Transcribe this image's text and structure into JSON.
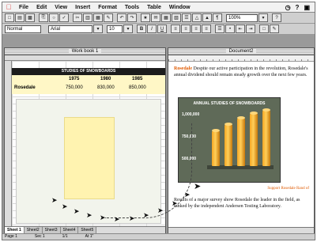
{
  "menubar": {
    "items": [
      "File",
      "Edit",
      "View",
      "Insert",
      "Format",
      "Tools",
      "Table",
      "Window"
    ]
  },
  "toolbar": {
    "zoom": "100%",
    "style": "Normal",
    "font": "Arial",
    "size": "10"
  },
  "excel": {
    "title": "Work book 1",
    "banner": "STUDIES OF SNOWBOARDS",
    "years": [
      "1975",
      "1980",
      "1985"
    ],
    "row_label": "Rosedale",
    "values": [
      "750,000",
      "830,000",
      "850,000"
    ],
    "sheets": [
      "Sheet 1",
      "Sheet2",
      "Sheet3",
      "Sheet4",
      "Sheet5"
    ]
  },
  "word": {
    "title": "Document2",
    "para1_highlight": "Rosedale",
    "para1": "Despite our active participation in the revolution, Rosedale's annual dividend should remain steady growth over the next few years.",
    "chart_title": "ANNUAL STUDIES OF SNOWBOARDS",
    "ticks": [
      "1,000,000",
      "750,000",
      "500,000"
    ],
    "support_link": "Support Rosedale Rand of",
    "para2": "Results of a major survey show Rosedale the leader in the field, as ranked by the independent Andersen Testing Laboratory."
  },
  "status": {
    "items": [
      "Page 1",
      "Sec 1",
      "1/1",
      "At 1\""
    ]
  },
  "colors": {
    "highlight": "#e05a00",
    "bar": "#f6a623",
    "yellow_fill": "#fff7c6"
  }
}
